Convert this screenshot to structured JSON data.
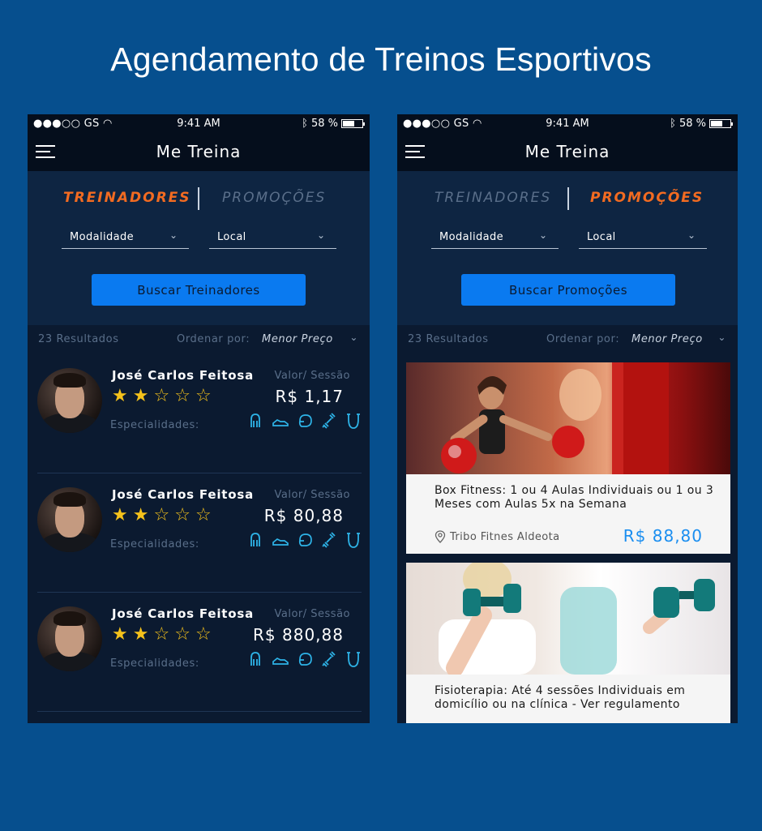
{
  "page_title": "Agendamento de Treinos Esportivos",
  "status_bar": {
    "carrier": "●●●○○ GS",
    "time": "9:41 AM",
    "battery": "58 %",
    "battery_level": 0.58
  },
  "app": {
    "title": "Me Treina"
  },
  "tabs": {
    "trainers": "TREINADORES",
    "promotions": "PROMOÇÕES"
  },
  "filters": {
    "modalidade": "Modalidade",
    "local": "Local"
  },
  "colors": {
    "active_tab": "#f26b21",
    "primary_button": "#0a7af0",
    "star": "#f5c21b",
    "promo_price": "#1a8ef0"
  },
  "left_screen": {
    "active_tab": "trainers",
    "search_button": "Buscar Treinadores",
    "results_count": "23 Resultados",
    "order_label": "Ordenar por:",
    "order_value": "Menor Preço",
    "trainers": [
      {
        "name": "José Carlos Feitosa",
        "rating": 2,
        "price_label": "Valor/ Sessão",
        "price": "R$ 1,17",
        "specialties_label": "Especialidades:"
      },
      {
        "name": "José Carlos Feitosa",
        "rating": 2,
        "price_label": "Valor/ Sessão",
        "price": "R$ 80,88",
        "specialties_label": "Especialidades:"
      },
      {
        "name": "José Carlos Feitosa",
        "rating": 2,
        "price_label": "Valor/ Sessão",
        "price": "R$ 880,88",
        "specialties_label": "Especialidades:"
      }
    ],
    "specialty_icons": [
      "hand-grip-icon",
      "running-shoe-icon",
      "boxing-glove-icon",
      "dumbbell-icon",
      "jump-rope-icon"
    ]
  },
  "right_screen": {
    "active_tab": "promotions",
    "search_button": "Buscar Promoções",
    "results_count": "23 Resultados",
    "order_label": "Ordenar por:",
    "order_value": "Menor Preço",
    "promotions": [
      {
        "title": "Box Fitness: 1 ou 4 Aulas Individuais ou 1 ou 3 Meses com Aulas 5x na Semana",
        "location": "Tribo Fitnes Aldeota",
        "price": "R$ 88,80",
        "image": "boxing-image"
      },
      {
        "title": "Fisioterapia: Até 4 sessões Individuais em domicílio ou na clínica - Ver regulamento",
        "location": "",
        "price": "",
        "image": "dumbbell-image"
      }
    ]
  }
}
